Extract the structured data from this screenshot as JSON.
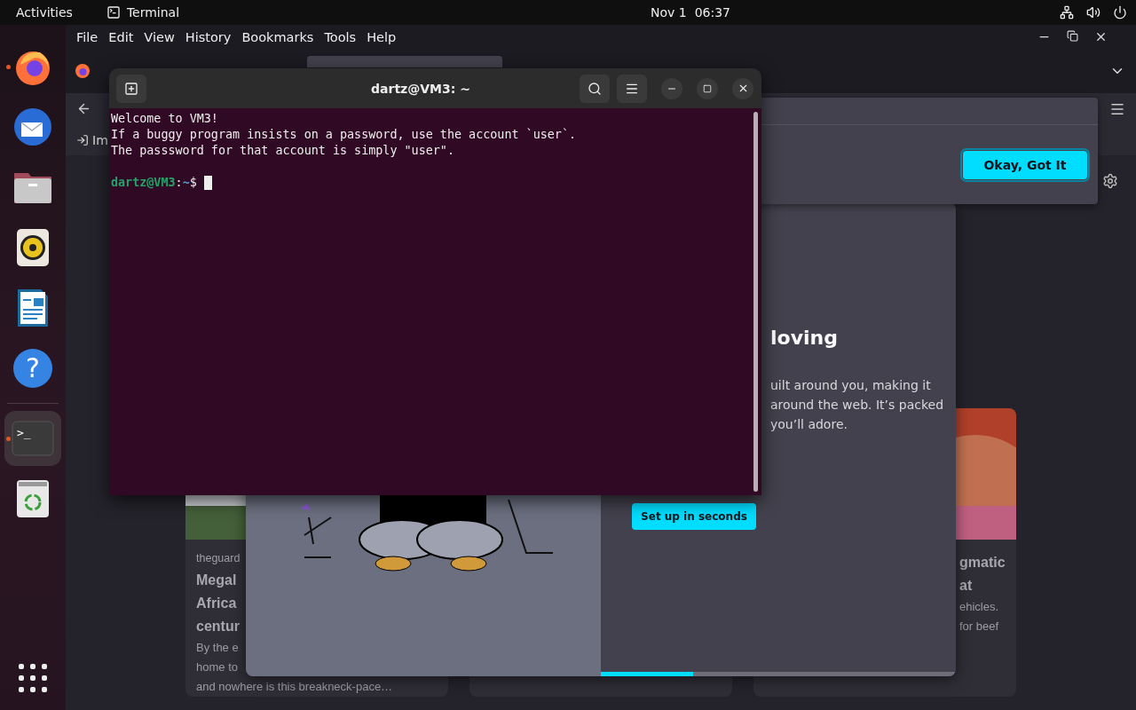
{
  "top_bar": {
    "activities": "Activities",
    "app_name": "Terminal",
    "clock": "Nov 1  06:37"
  },
  "dock": {
    "items": [
      {
        "kind": "firefox",
        "running": true,
        "selected": false
      },
      {
        "kind": "thunderbird",
        "running": false,
        "selected": false
      },
      {
        "kind": "files",
        "running": false,
        "selected": false
      },
      {
        "kind": "rhythmbox",
        "running": false,
        "selected": false
      },
      {
        "kind": "writer",
        "running": false,
        "selected": false
      },
      {
        "kind": "help",
        "running": false,
        "selected": false,
        "glyph": "?"
      },
      {
        "kind": "terminal",
        "running": true,
        "selected": true,
        "glyph": ">_"
      },
      {
        "kind": "trash",
        "running": false,
        "selected": false
      }
    ]
  },
  "browser": {
    "menu": [
      "File",
      "Edit",
      "View",
      "History",
      "Bookmarks",
      "Tools",
      "Help"
    ],
    "bookmark": "Im",
    "notification": {
      "button": "Okay, Got It"
    },
    "onboarding": {
      "title": "loving",
      "text_lines": [
        "uilt around you, making it",
        "around the web. It’s packed",
        "you’ll adore."
      ],
      "button": "Set up in seconds",
      "progress": {
        "level": 0.25
      }
    },
    "cards": [
      {
        "source": "theguard",
        "title_lines": [
          "Megal",
          "Africa",
          "centur"
        ],
        "text_lines": [
          "By the e",
          "home to",
          "and nowhere is this breakneck-pace…"
        ]
      },
      {
        "title_lines": [
          "gmatic",
          "at"
        ],
        "text_lines": [
          "ehicles.",
          "for beef"
        ]
      }
    ]
  },
  "terminal": {
    "title": "dartz@VM3: ~",
    "lines": [
      "Welcome to VM3!",
      "If a buggy program insists on a password, use the account `user`.",
      "The passsword for that account is simply \"user\"."
    ],
    "prompt": {
      "user_host": "dartz@VM3",
      "separator": ":",
      "path": "~",
      "symbol": "$"
    }
  }
}
